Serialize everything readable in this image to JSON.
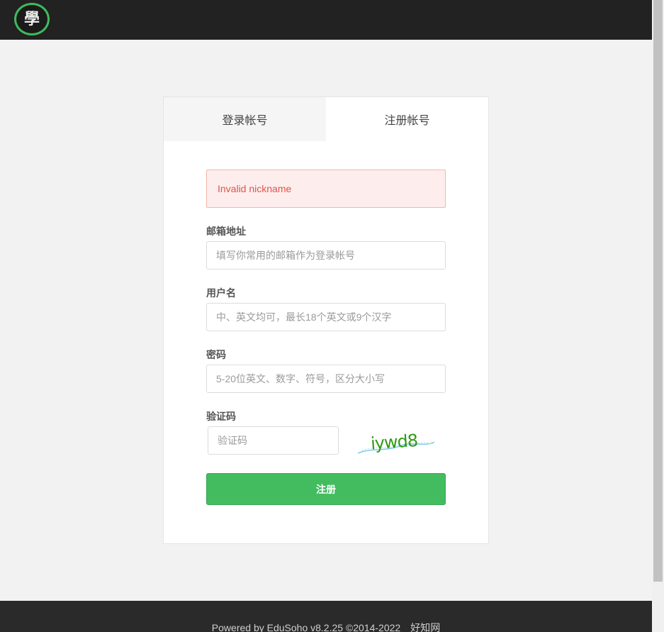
{
  "header": {
    "logo_text": "學"
  },
  "tabs": [
    {
      "label": "登录帐号"
    },
    {
      "label": "注册帐号"
    }
  ],
  "form": {
    "alert": "Invalid nickname",
    "email": {
      "label": "邮箱地址",
      "placeholder": "填写你常用的邮箱作为登录帐号",
      "value": ""
    },
    "username": {
      "label": "用户名",
      "placeholder": "中、英文均可，最长18个英文或9个汉字",
      "value": ""
    },
    "password": {
      "label": "密码",
      "placeholder": "5-20位英文、数字、符号，区分大小写",
      "value": ""
    },
    "captcha": {
      "label": "验证码",
      "placeholder": "验证码",
      "value": "",
      "image_text": "iywd8"
    },
    "submit_label": "注册"
  },
  "footer": {
    "text": "Powered by EduSoho v8.2.25 ©2014-2022",
    "link": "好知网"
  },
  "colors": {
    "accent": "#43bc60",
    "header_bg": "#222222",
    "alert_text": "#e0534a",
    "alert_bg": "#fdeeed"
  }
}
